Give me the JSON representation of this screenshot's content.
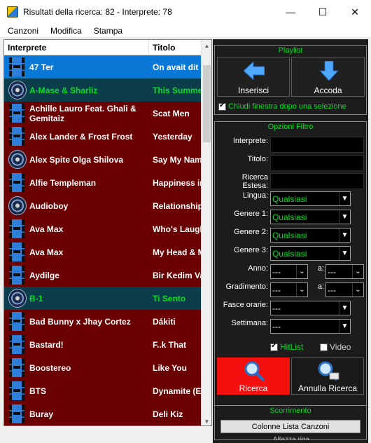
{
  "window": {
    "title": "Risultati della ricerca: 82 - Interprete: 78",
    "minimize": "—",
    "maximize": "☐",
    "close": "✕"
  },
  "menu": [
    "Canzoni",
    "Modifica",
    "Stampa"
  ],
  "list": {
    "columns": [
      "Interprete",
      "Titolo"
    ],
    "rows": [
      {
        "icon": "film",
        "interprete": "47 Ter",
        "titolo": "On avait dit",
        "style": "sel"
      },
      {
        "icon": "disc",
        "interprete": "A-Mase & Sharliz",
        "titolo": "This Summer",
        "style": "teal"
      },
      {
        "icon": "film",
        "interprete": "Achille Lauro Feat. Ghali & Gemitaiz",
        "titolo": "Scat Men",
        "style": "normal"
      },
      {
        "icon": "film",
        "interprete": "Alex Lander & Frost Frost",
        "titolo": "Yesterday",
        "style": "normal"
      },
      {
        "icon": "disc",
        "interprete": "Alex Spite Olga Shilova",
        "titolo": "Say My Name",
        "style": "normal"
      },
      {
        "icon": "film",
        "interprete": "Alfie Templeman",
        "titolo": "Happiness in",
        "style": "normal"
      },
      {
        "icon": "disc",
        "interprete": "Audioboy",
        "titolo": "Relationship",
        "style": "normal"
      },
      {
        "icon": "film",
        "interprete": "Ava Max",
        "titolo": "Who's Laugh",
        "style": "normal"
      },
      {
        "icon": "film",
        "interprete": "Ava Max",
        "titolo": "My Head & M",
        "style": "normal"
      },
      {
        "icon": "film",
        "interprete": "Aydilge",
        "titolo": "Bir Kedim Va",
        "style": "normal"
      },
      {
        "icon": "disc",
        "interprete": "B-1",
        "titolo": "Ti Sento",
        "style": "teal"
      },
      {
        "icon": "film",
        "interprete": "Bad Bunny x Jhay Cortez",
        "titolo": "Dákiti",
        "style": "normal"
      },
      {
        "icon": "film",
        "interprete": "Bastard!",
        "titolo": "F..k That",
        "style": "normal"
      },
      {
        "icon": "film",
        "interprete": "Boostereo",
        "titolo": "Like You",
        "style": "normal"
      },
      {
        "icon": "film",
        "interprete": "BTS",
        "titolo": "Dynamite (E",
        "style": "normal"
      },
      {
        "icon": "film",
        "interprete": "Buray",
        "titolo": "Deli Kiz",
        "style": "normal"
      }
    ]
  },
  "playlist": {
    "group_label": "Playlist",
    "inserisci": "Inserisci",
    "accoda": "Accoda",
    "chiudi_label": "Chiudi finestra dopo una selezione"
  },
  "filtro": {
    "group_label": "Opzioni Filtro",
    "interprete_label": "Interprete:",
    "titolo_label": "Titolo:",
    "ricerca_estesa_label": "Ricerca Estesa:",
    "lingua_label": "Lingua:",
    "lingua_value": "Qualsiasi",
    "genere1_label": "Genere 1:",
    "genere1_value": "Qualsiasi",
    "genere2_label": "Genere 2:",
    "genere2_value": "Qualsiasi",
    "genere3_label": "Genere 3:",
    "genere3_value": "Qualsiasi",
    "anno_label": "Anno:",
    "anno_from": "---",
    "anno_to": "---",
    "a_label": "a:",
    "gradimento_label": "Gradimento:",
    "gradimento_from": "---",
    "gradimento_to": "---",
    "fasce_label": "Fasce orarie:",
    "fasce_value": "---",
    "settimana_label": "Settimana:",
    "settimana_value": "---",
    "hitlist_label": "HitList",
    "video_label": "Video",
    "ricerca_button": "Ricerca",
    "annulla_button": "Annulla Ricerca"
  },
  "scorrimento": {
    "group_label": "Scorrimento",
    "colonne_button": "Colonne Lista Canzoni",
    "partial_label": "Altezza riga"
  },
  "colors": {
    "row_bg": "#6b0000",
    "selected_bg": "#0a78d7",
    "teal_bg": "#0b3d4a",
    "green_text": "#00e020",
    "ricerca_red": "#f51010"
  }
}
